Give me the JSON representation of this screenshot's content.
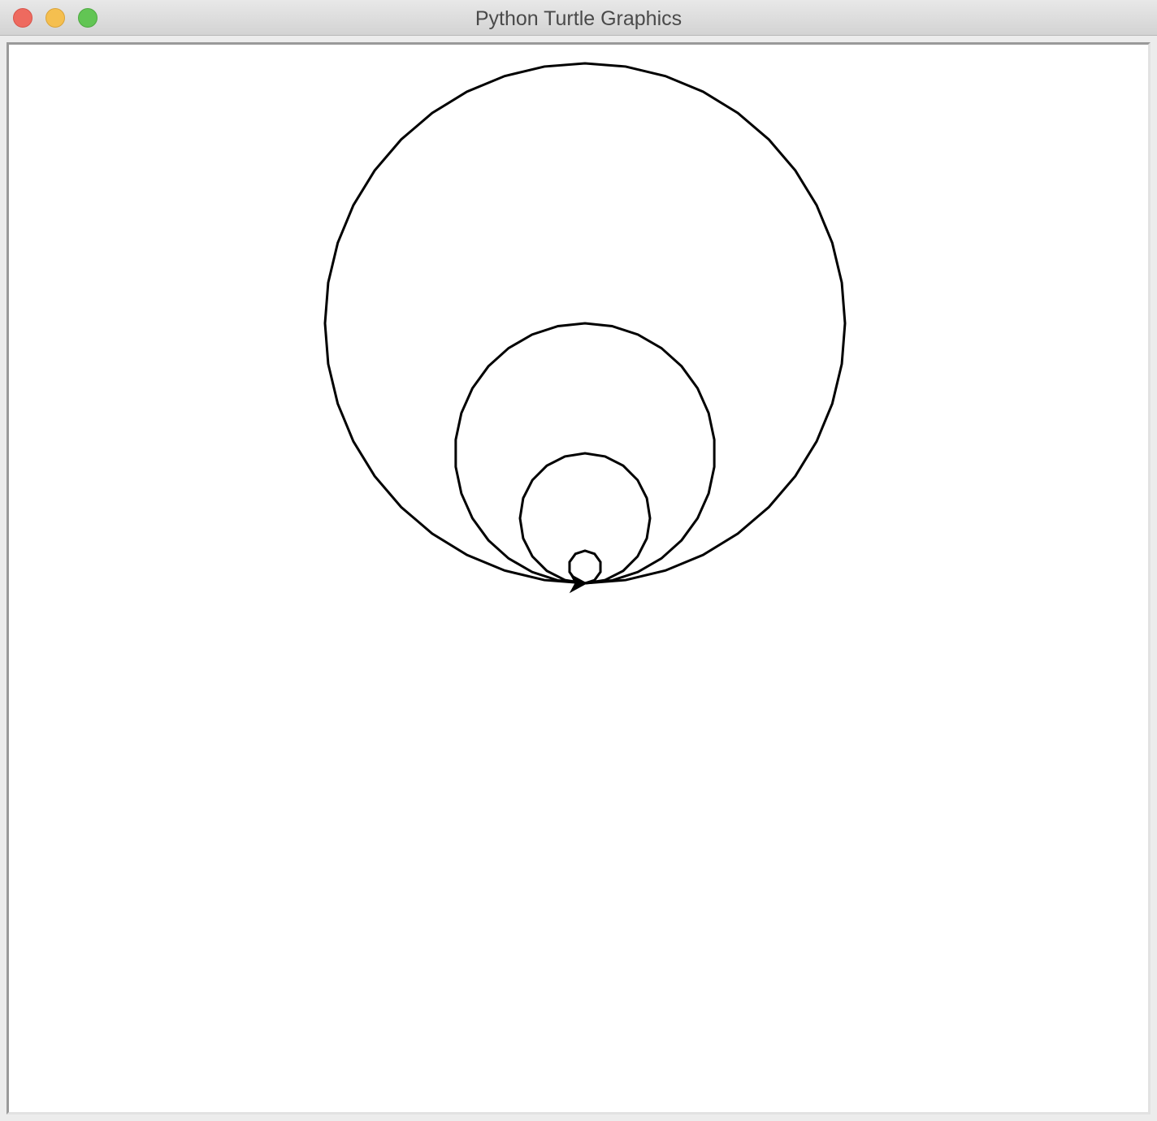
{
  "window": {
    "title": "Python Turtle Graphics"
  },
  "colors": {
    "pen": "#000000",
    "canvas_background": "#ffffff",
    "close_button": "#ee6a5f",
    "minimize_button": "#f5bf4f",
    "zoom_button": "#62c554"
  },
  "icons": {
    "close": "close-icon",
    "minimize": "minimize-icon",
    "zoom": "zoom-icon",
    "turtle": "turtle-arrow-icon"
  },
  "drawing": {
    "circles": [
      {
        "radius_units": 320,
        "segments": 40
      },
      {
        "radius_units": 160,
        "segments": 30
      },
      {
        "radius_units": 80,
        "segments": 20
      },
      {
        "radius_units": 20,
        "segments": 10
      }
    ],
    "turtle_shape": "classic",
    "turtle_heading_degrees": 0
  }
}
